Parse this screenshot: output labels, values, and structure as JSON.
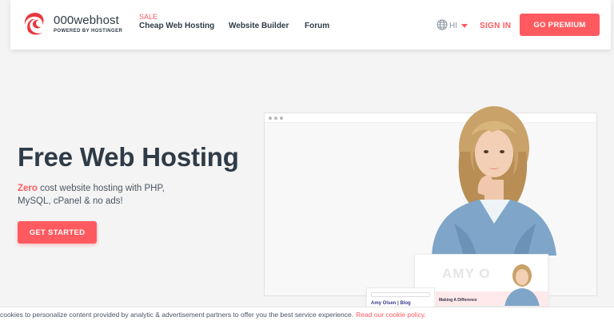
{
  "header": {
    "logo_name": "000webhost",
    "logo_sub": "POWERED BY HOSTINGER",
    "nav": {
      "sale_badge": "SALE",
      "cheap_hosting": "Cheap Web Hosting",
      "website_builder": "Website Builder",
      "forum": "Forum"
    },
    "language": "HI",
    "sign_in": "SIGN IN",
    "go_premium": "GO PREMIUM"
  },
  "hero": {
    "title": "Free Web Hosting",
    "desc_highlight": "Zero",
    "desc_rest": " cost website hosting with PHP, MySQL, cPanel & no ads!",
    "cta": "GET STARTED"
  },
  "preview": {
    "card_name": "AMY O",
    "card_text_line1": "Making A Difference",
    "card_text_line2": "",
    "blog_title": "Amy Olsen | Blog"
  },
  "cookie": {
    "text": "cookies to personalize content provided by analytic & advertisement partners to offer you the best service experience.",
    "link": "Read our cookie policy."
  },
  "colors": {
    "accent": "#ff5a5f",
    "text_dark": "#2f3b47",
    "background": "#f4f4f4"
  }
}
